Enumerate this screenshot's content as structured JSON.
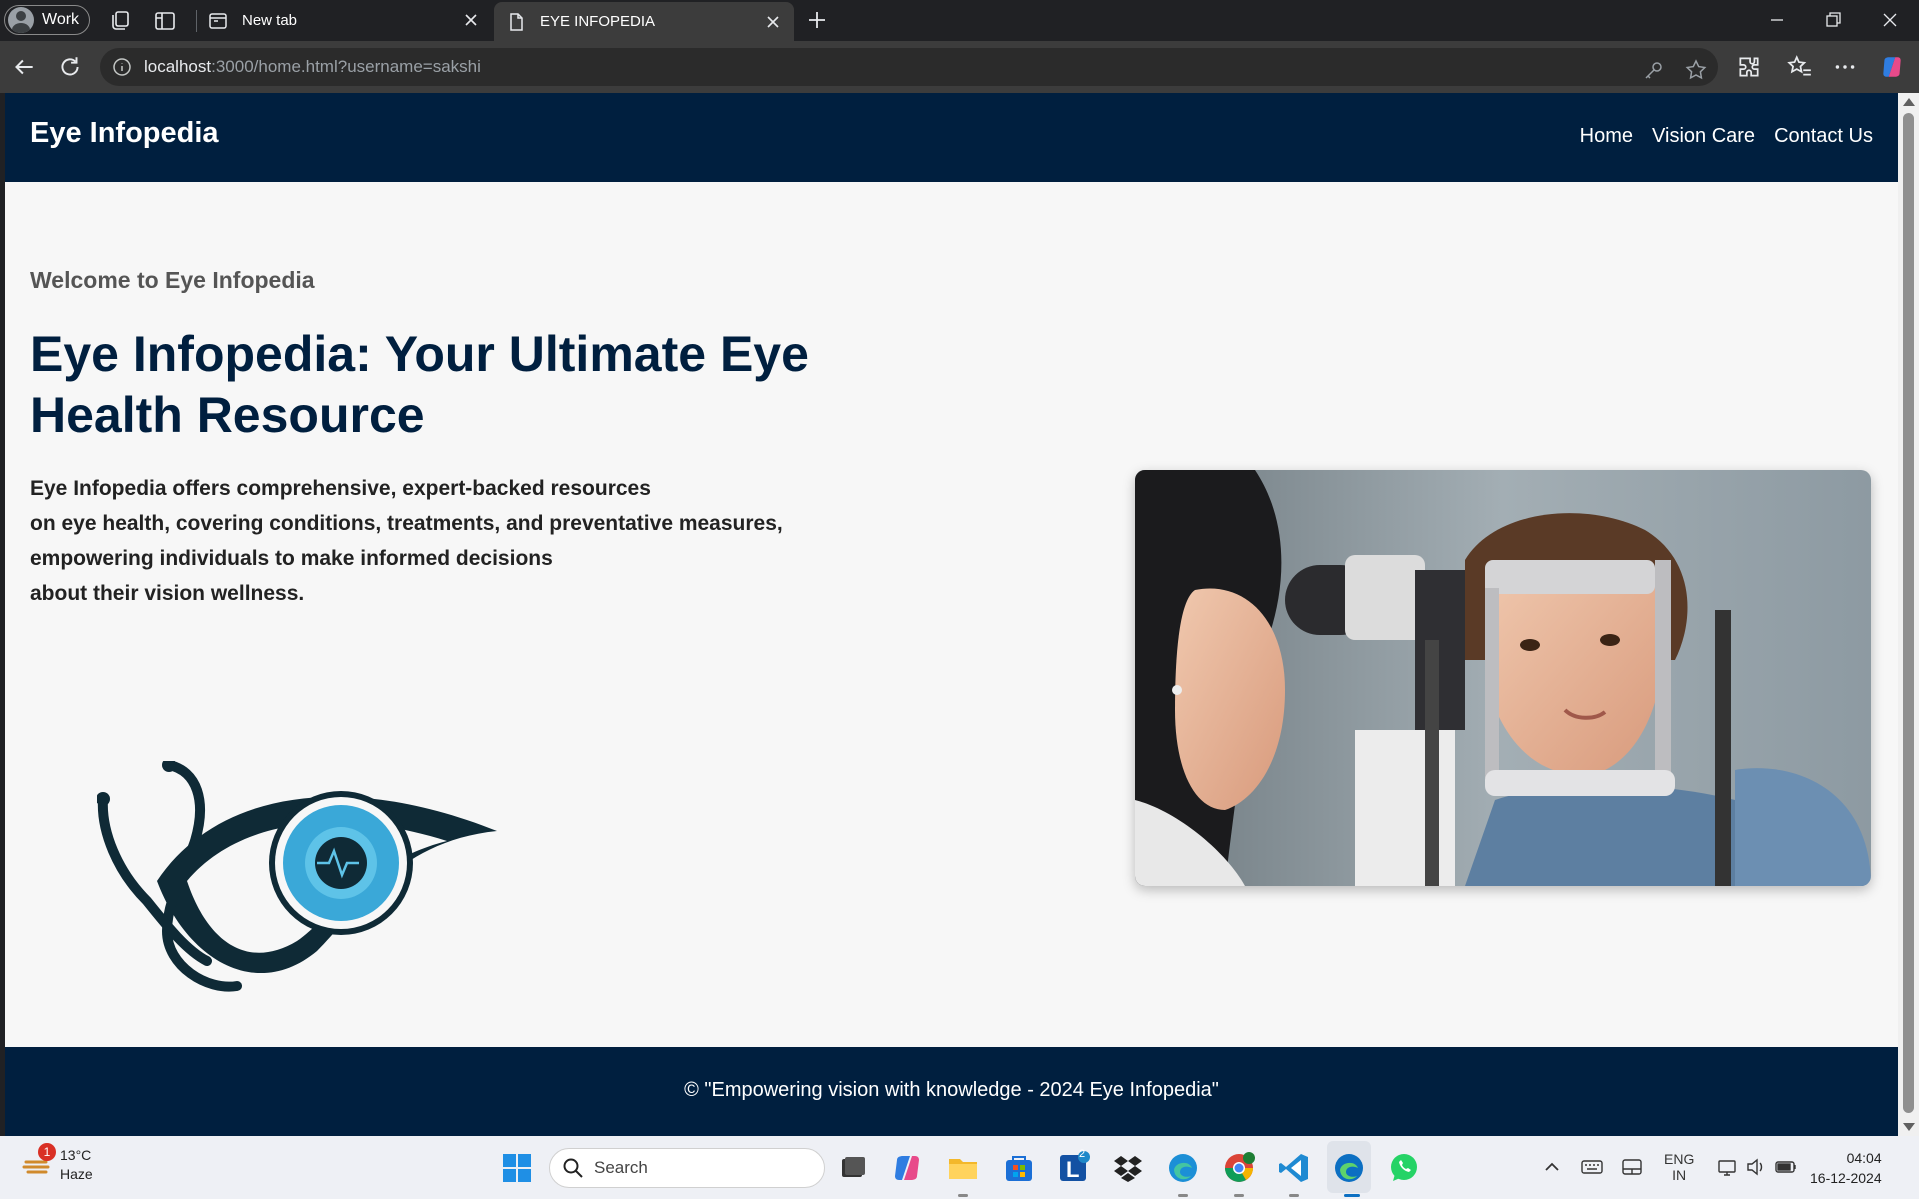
{
  "browser": {
    "profile_label": "Work",
    "tabs": [
      {
        "label": "New tab"
      },
      {
        "label": "EYE INFOPEDIA"
      }
    ],
    "url_host": "localhost",
    "url_rest": ":3000/home.html?username=sakshi"
  },
  "site": {
    "brand": "Eye Infopedia",
    "nav": [
      "Home",
      "Vision Care",
      "Contact Us"
    ],
    "welcome": "Welcome to Eye Infopedia",
    "headline": "Eye Infopedia: Your Ultimate Eye Health Resource",
    "intro_lines": [
      "Eye Infopedia offers comprehensive, expert-backed resources",
      "on eye health, covering conditions, treatments, and preventative measures,",
      "empowering individuals to make informed decisions",
      "about their vision wellness."
    ],
    "footer": "© \"Empowering vision with knowledge - 2024 Eye Infopedia\""
  },
  "colors": {
    "navy": "#001f3f",
    "page_bg": "#f7f7f7"
  },
  "taskbar": {
    "weather_temp": "13°C",
    "weather_desc": "Haze",
    "weather_badge": "1",
    "search_label": "Search",
    "lang_top": "ENG",
    "lang_bottom": "IN",
    "time": "04:04",
    "date": "16-12-2024",
    "store_badge": "2"
  }
}
